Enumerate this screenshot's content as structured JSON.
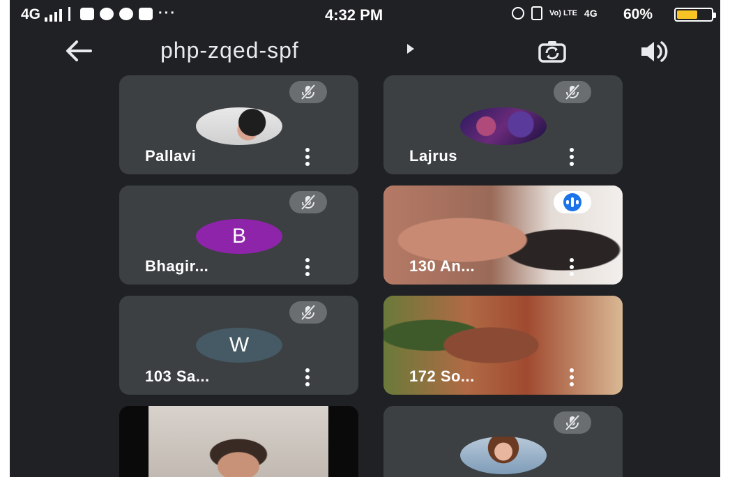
{
  "status_bar": {
    "network": "4G",
    "more": "···",
    "time": "4:32 PM",
    "volte": "Vo) LTE",
    "net_type": "4G",
    "battery_text": "60%",
    "battery_level": 0.6
  },
  "app_bar": {
    "back_icon": "arrow-left-icon",
    "meeting_code": "php-zqed-spf",
    "switch_camera_icon": "switch-camera-icon",
    "audio_icon": "speaker-icon"
  },
  "colors": {
    "background": "#202124",
    "tile": "#3c4043",
    "avatar_b": "#8e24aa",
    "avatar_w": "#455a64",
    "speaking_blue": "#1a73e8"
  },
  "participants": [
    {
      "name": "Pallavi",
      "type": "photo",
      "muted": true
    },
    {
      "name": "Lajrus",
      "type": "photo",
      "muted": true
    },
    {
      "name": "Bhagir...",
      "type": "letter",
      "letter": "B",
      "muted": true
    },
    {
      "name": "130 An...",
      "type": "video",
      "muted": false,
      "speaking": true
    },
    {
      "name": "103 Sa...",
      "type": "letter",
      "letter": "W",
      "muted": true
    },
    {
      "name": "172 So...",
      "type": "video",
      "muted": false
    },
    {
      "name": "",
      "type": "video",
      "muted": false
    },
    {
      "name": "",
      "type": "photo",
      "muted": true
    }
  ]
}
